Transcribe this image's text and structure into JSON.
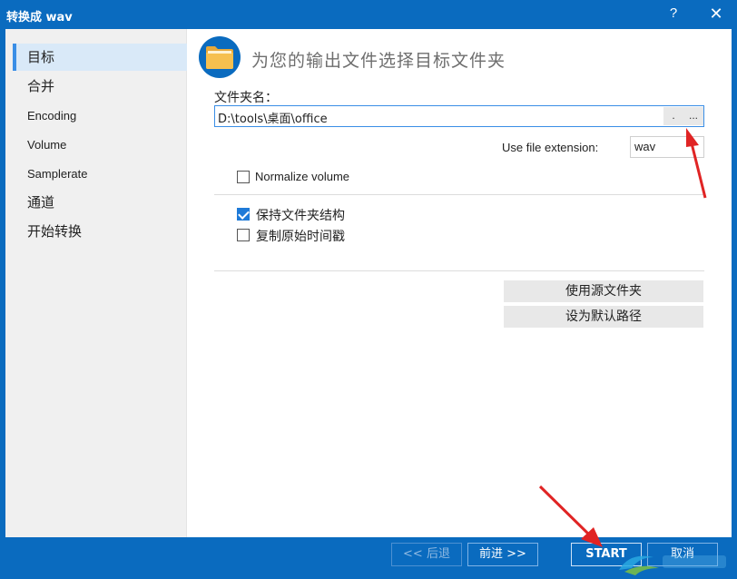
{
  "window": {
    "title": "转换成 wav",
    "help_label": "?",
    "close_label": "✕"
  },
  "sidebar": {
    "items": [
      {
        "label": "目标",
        "active": true
      },
      {
        "label": "合并"
      },
      {
        "label": "Encoding"
      },
      {
        "label": "Volume"
      },
      {
        "label": "Samplerate"
      },
      {
        "label": "通道"
      },
      {
        "label": "开始转换"
      }
    ]
  },
  "main": {
    "heading": "为您的输出文件选择目标文件夹",
    "folder_label": "文件夹名：",
    "folder_value": "D:\\tools\\桌面\\office",
    "folder_btn_dot": ".",
    "folder_btn_browse": "...",
    "ext_label": "Use file extension:",
    "ext_value": "wav",
    "normalize_label": "Normalize volume",
    "normalize_checked": false,
    "keep_structure_label": "保持文件夹结构",
    "keep_structure_checked": true,
    "copy_timestamp_label": "复制原始时间戳",
    "copy_timestamp_checked": false,
    "use_source_folder_btn": "使用源文件夹",
    "set_default_path_btn": "设为默认路径"
  },
  "footer": {
    "back_label": "<< 后退",
    "next_label": "前进 >>",
    "start_label": "START",
    "cancel_label": "取消"
  },
  "colors": {
    "accent": "#0a6bbf",
    "arrow": "#e02424",
    "folder": "#f6c04f"
  },
  "icons": [
    "folder-icon",
    "help-icon",
    "close-icon",
    "checkmark-icon"
  ]
}
